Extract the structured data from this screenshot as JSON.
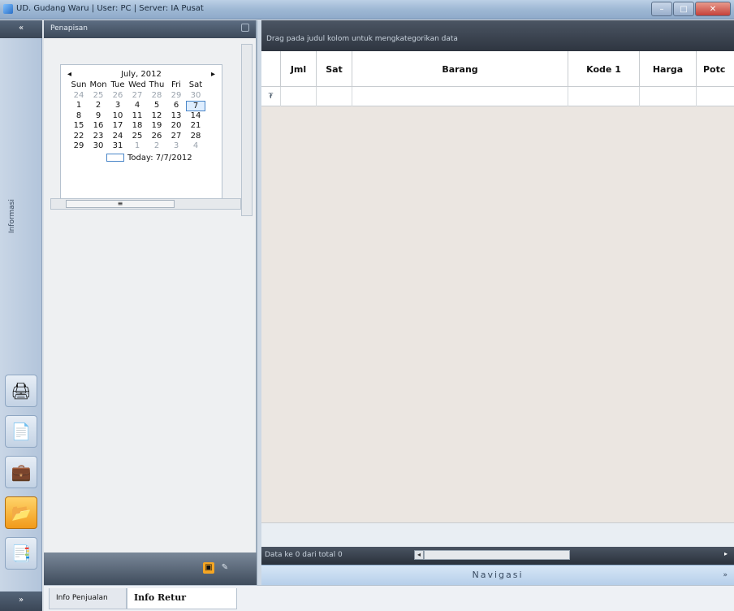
{
  "window": {
    "title": "UD. Gudang Waru | User: PC | Server: IA Pusat",
    "min_label": "–",
    "max_label": "□",
    "close_label": "✕"
  },
  "navstrip": {
    "top_label": "«",
    "vertical_label": "Informasi",
    "bottom_label": "»",
    "icons": [
      {
        "name": "printer-icon",
        "glyph": "🖨"
      },
      {
        "name": "document-icon",
        "glyph": "📄"
      },
      {
        "name": "briefcase-icon",
        "glyph": "💼"
      },
      {
        "name": "folder-icon",
        "glyph": "📂"
      },
      {
        "name": "report-icon",
        "glyph": "📑"
      }
    ]
  },
  "sidepanel": {
    "title": "Penapisan",
    "calendar": {
      "month_label": "July, 2012",
      "prev": "◂",
      "next": "▸",
      "days_of_week": [
        "Sun",
        "Mon",
        "Tue",
        "Wed",
        "Thu",
        "Fri",
        "Sat"
      ],
      "weeks": [
        [
          "24",
          "25",
          "26",
          "27",
          "28",
          "29",
          "30"
        ],
        [
          "1",
          "2",
          "3",
          "4",
          "5",
          "6",
          "7"
        ],
        [
          "8",
          "9",
          "10",
          "11",
          "12",
          "13",
          "14"
        ],
        [
          "15",
          "16",
          "17",
          "18",
          "19",
          "20",
          "21"
        ],
        [
          "22",
          "23",
          "24",
          "25",
          "26",
          "27",
          "28"
        ],
        [
          "29",
          "30",
          "31",
          "1",
          "2",
          "3",
          "4"
        ]
      ],
      "today_label": "Today: 7/7/2012"
    },
    "hscroll_thumb": "≡"
  },
  "grid": {
    "group_hint": "Drag pada judul kolom untuk mengkategorikan data",
    "columns": [
      "Jml",
      "Sat",
      "Barang",
      "Kode 1",
      "Harga",
      "Potc"
    ],
    "filter_icon": "₮",
    "navigator_text": "Data ke 0 dari total 0",
    "nav_section_label": "Navigasi",
    "nav_section_chevron": "»"
  },
  "bottom_tabs": [
    "Info Penjualan",
    "Info Retur Penjualan"
  ],
  "colors": {
    "accent": "#f19a1a",
    "header_dark": "#3d4a5a",
    "grid_bg": "#ebe6e1"
  }
}
